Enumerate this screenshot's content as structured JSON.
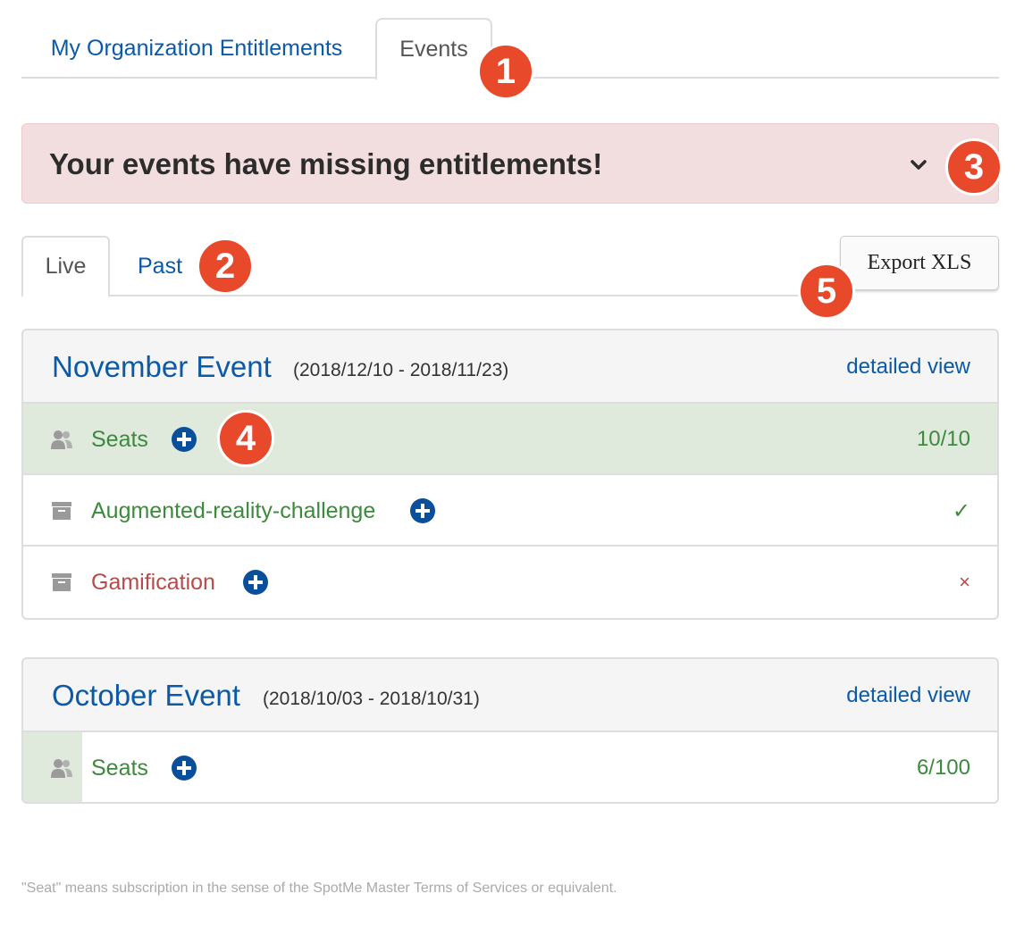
{
  "tabs": {
    "org_entitlements": "My Organization Entitlements",
    "events": "Events"
  },
  "alert": {
    "title": "Your events have missing entitlements!"
  },
  "sub_tabs": {
    "live": "Live",
    "past": "Past"
  },
  "export_label": "Export XLS",
  "events": [
    {
      "name": "November Event",
      "dates": "(2018/12/10 - 2018/11/23)",
      "detail_link": "detailed view",
      "rows": [
        {
          "icon": "users-icon",
          "label": "Seats",
          "value": "10/10",
          "status": "success"
        },
        {
          "icon": "archive-box-icon",
          "label": "Augmented-reality-challenge",
          "value": "✓",
          "status": "ok"
        },
        {
          "icon": "archive-box-icon",
          "label": "Gamification",
          "value": "×",
          "status": "missing"
        }
      ]
    },
    {
      "name": "October Event",
      "dates": "(2018/10/03 - 2018/10/31)",
      "detail_link": "detailed view",
      "rows": [
        {
          "icon": "users-icon",
          "label": "Seats",
          "value": "6/100",
          "status": "ok"
        }
      ]
    }
  ],
  "badges": [
    "1",
    "2",
    "3",
    "4",
    "5"
  ],
  "footnote": "\"Seat\" means subscription in the sense of the SpotMe Master Terms of Services or equivalent.",
  "colors": {
    "link": "#0a5aa8",
    "success_text": "#3c8a3c",
    "danger_text": "#b94a48",
    "alert_bg": "#f2dede",
    "success_bg": "#dfe9dc",
    "badge": "#e8492b"
  }
}
